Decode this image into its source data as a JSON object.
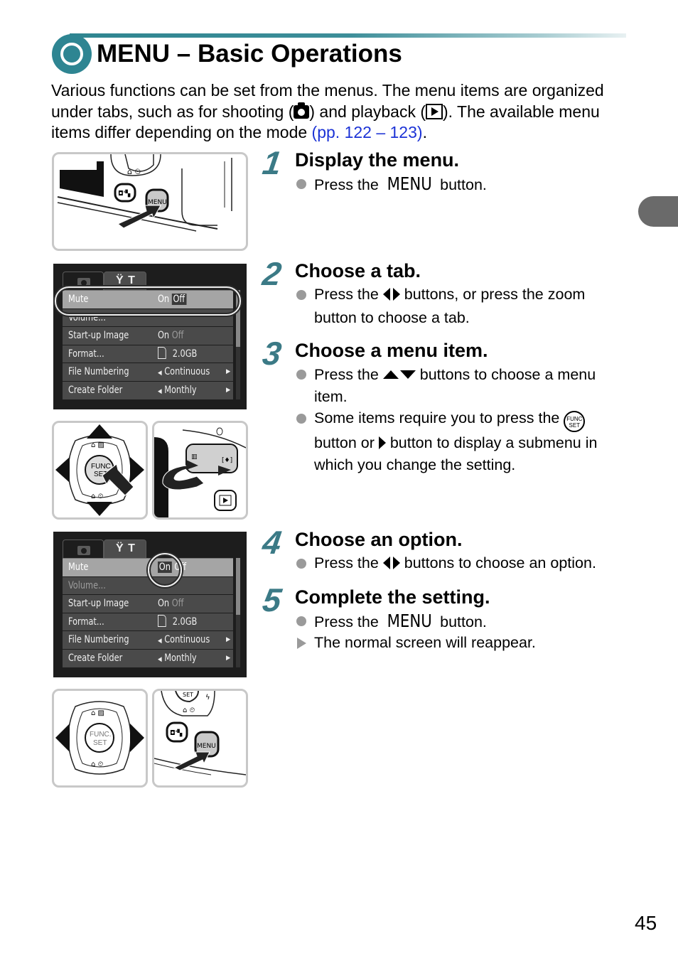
{
  "header": {
    "title": "MENU – Basic Operations",
    "accent_color": "#2e8592"
  },
  "intro": {
    "text_1": "Various functions can be set from the menus. The menu items are organized under tabs, such as for shooting (",
    "icon_1": "camera-icon",
    "text_2": ") and playback (",
    "icon_2": "playback-icon",
    "text_3": "). The available menu items differ depending on the mode ",
    "link": "(pp. 122 – 123)",
    "text_4": ".",
    "link_color": "#1c33d6"
  },
  "steps": [
    {
      "number": "1",
      "title": "Display the menu.",
      "bullets": [
        {
          "type": "dot",
          "before": "Press the ",
          "key": "MENU",
          "after": " button."
        }
      ]
    },
    {
      "number": "2",
      "title": "Choose a tab.",
      "bullets": [
        {
          "type": "dot",
          "before": "Press the ",
          "key": "left-right-buttons-icon",
          "after": " buttons, or press the zoom button to choose a tab."
        }
      ]
    },
    {
      "number": "3",
      "title": "Choose a menu item.",
      "bullets": [
        {
          "type": "dot",
          "before": "Press the ",
          "key": "up-down-buttons-icon",
          "after": " buttons to choose a menu item."
        },
        {
          "type": "dot",
          "before": "Some items require you to press the ",
          "key": "func-set-icon",
          "middle": " button or ",
          "key2": "right-button-icon",
          "after": " button to display a submenu in which you change the setting."
        }
      ]
    },
    {
      "number": "4",
      "title": "Choose an option.",
      "bullets": [
        {
          "type": "dot",
          "before": "Press the ",
          "key": "left-right-buttons-icon",
          "after": " buttons to choose an option."
        }
      ]
    },
    {
      "number": "5",
      "title": "Complete the setting.",
      "bullets": [
        {
          "type": "dot",
          "before": "Press the ",
          "key": "MENU",
          "after": " button."
        },
        {
          "type": "result",
          "text": "The normal screen will reappear."
        }
      ]
    }
  ],
  "func_set_icon": {
    "line1": "FUNC",
    "line2": "SET"
  },
  "illustrations": {
    "menu_button_label": "MENU",
    "func_set_label_1": "FUNC.",
    "func_set_label_2": "SET"
  },
  "camera_menu_1": {
    "tabs": [
      "camera-tab",
      "setup-tab"
    ],
    "setup_tab_glyph": "Ÿ T",
    "rows": [
      {
        "label": "Mute",
        "value_a": "On",
        "value_b": "Off",
        "selected": true,
        "highlight": "b"
      },
      {
        "label": "Volume...",
        "value_a": "",
        "value_b": "",
        "selected": false
      },
      {
        "label": "Start-up Image",
        "value_a": "On",
        "value_b": "Off",
        "selected": false
      },
      {
        "label": "Format...",
        "value_a": "2.0GB",
        "value_b": "",
        "selected": false,
        "card": true
      },
      {
        "label": "File Numbering",
        "value_a": "Continuous",
        "value_b": "",
        "selected": false,
        "arrows": true
      },
      {
        "label": "Create Folder",
        "value_a": "Monthly",
        "value_b": "",
        "selected": false,
        "arrows": true
      }
    ]
  },
  "camera_menu_2": {
    "rows": [
      {
        "label": "Mute",
        "value_a": "On",
        "value_b": "Off",
        "selected": true,
        "highlight": "a"
      },
      {
        "label": "Volume...",
        "value_a": "",
        "value_b": "",
        "selected": false,
        "dim": true
      },
      {
        "label": "Start-up Image",
        "value_a": "On",
        "value_b": "Off",
        "selected": false
      },
      {
        "label": "Format...",
        "value_a": "2.0GB",
        "value_b": "",
        "selected": false,
        "card": true
      },
      {
        "label": "File Numbering",
        "value_a": "Continuous",
        "value_b": "",
        "selected": false,
        "arrows": true
      },
      {
        "label": "Create Folder",
        "value_a": "Monthly",
        "value_b": "",
        "selected": false,
        "arrows": true
      }
    ]
  },
  "thumb_tab_color": "#6a6a6a",
  "page_number": "45"
}
